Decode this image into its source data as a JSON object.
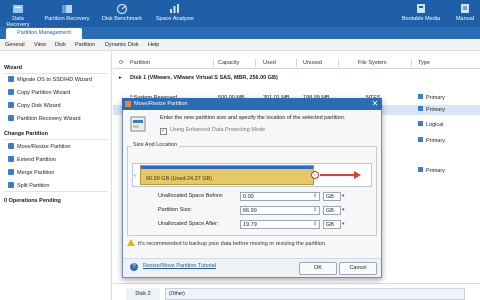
{
  "toolbar": {
    "items": [
      {
        "label": "Data Recovery",
        "icon": "data-recovery-icon"
      },
      {
        "label": "Partition Recovery",
        "icon": "partition-recovery-icon"
      },
      {
        "label": "Disk Benchmark",
        "icon": "disk-benchmark-icon"
      },
      {
        "label": "Space Analyzer",
        "icon": "space-analyzer-icon"
      },
      {
        "label": "Bootable Media",
        "icon": "bootable-media-icon"
      },
      {
        "label": "Manual",
        "icon": "manual-icon"
      }
    ]
  },
  "ribbon_tab": "Partition Management",
  "menu": [
    "General",
    "View",
    "Disk",
    "Partition",
    "Dynamic Disk",
    "Help"
  ],
  "sidebar": {
    "wizard_title": "Wizard",
    "wizard_items": [
      "Migrate OS to SSD/HD Wizard",
      "Copy Partition Wizard",
      "Copy Disk Wizard",
      "Partition Recovery Wizard"
    ],
    "change_title": "Change Partition",
    "change_items": [
      "Move/Resize Partition",
      "Extend Partition",
      "Merge Partition",
      "Split Partition"
    ],
    "pending": "0 Operations Pending"
  },
  "table": {
    "headers": [
      "Partition",
      "Capacity",
      "Used",
      "Unused",
      "File System",
      "Type"
    ],
    "disk1": "Disk 1 (VMware, VMware Virtual S SAS, MBR, 256.00 GB)",
    "rows": [
      {
        "partition": "*:System Reserved",
        "capacity": "500.00 MB",
        "used": "301.01 MB",
        "unused": "198.99 MB",
        "fs": "NTFS",
        "type": "Primary"
      },
      {
        "partition": "",
        "capacity": "",
        "used": "",
        "unused": "",
        "fs": "",
        "type": "Primary"
      },
      {
        "partition": "",
        "capacity": "",
        "used": "",
        "unused": "",
        "fs": "",
        "type": "Logical"
      },
      {
        "partition": "",
        "capacity": "",
        "used": "",
        "unused": "",
        "fs": "",
        "type": "Primary"
      },
      {
        "partition": "",
        "capacity": "",
        "used": "",
        "unused": "",
        "fs": "",
        "type": "Primary"
      }
    ]
  },
  "dialog": {
    "title": "Move/Resize Partition",
    "intro": "Enter the new partition size and specify the location of the selected partition.",
    "checkbox": "Using Enhanced Data Protecting Mode",
    "group_label": "Size And Location",
    "bar_text": "66.99 GB (Used:24.27 GB)",
    "bar_used_fraction": 0.73,
    "fields": [
      {
        "label": "Unallocated Space Before:",
        "value": "0.00",
        "unit": "GB"
      },
      {
        "label": "Partition Size:",
        "value": "66.99",
        "unit": "GB"
      },
      {
        "label": "Unallocated Space After:",
        "value": "19.79",
        "unit": "GB"
      }
    ],
    "warning": "It's recommended to backup your data before moving or resizing the partition.",
    "tutorial": "Resize/Move Partition Tutorial",
    "ok": "OK",
    "cancel": "Cancel"
  },
  "diskmap": {
    "disk2_label": "Disk 2",
    "disk2_fs": "(Other)"
  }
}
